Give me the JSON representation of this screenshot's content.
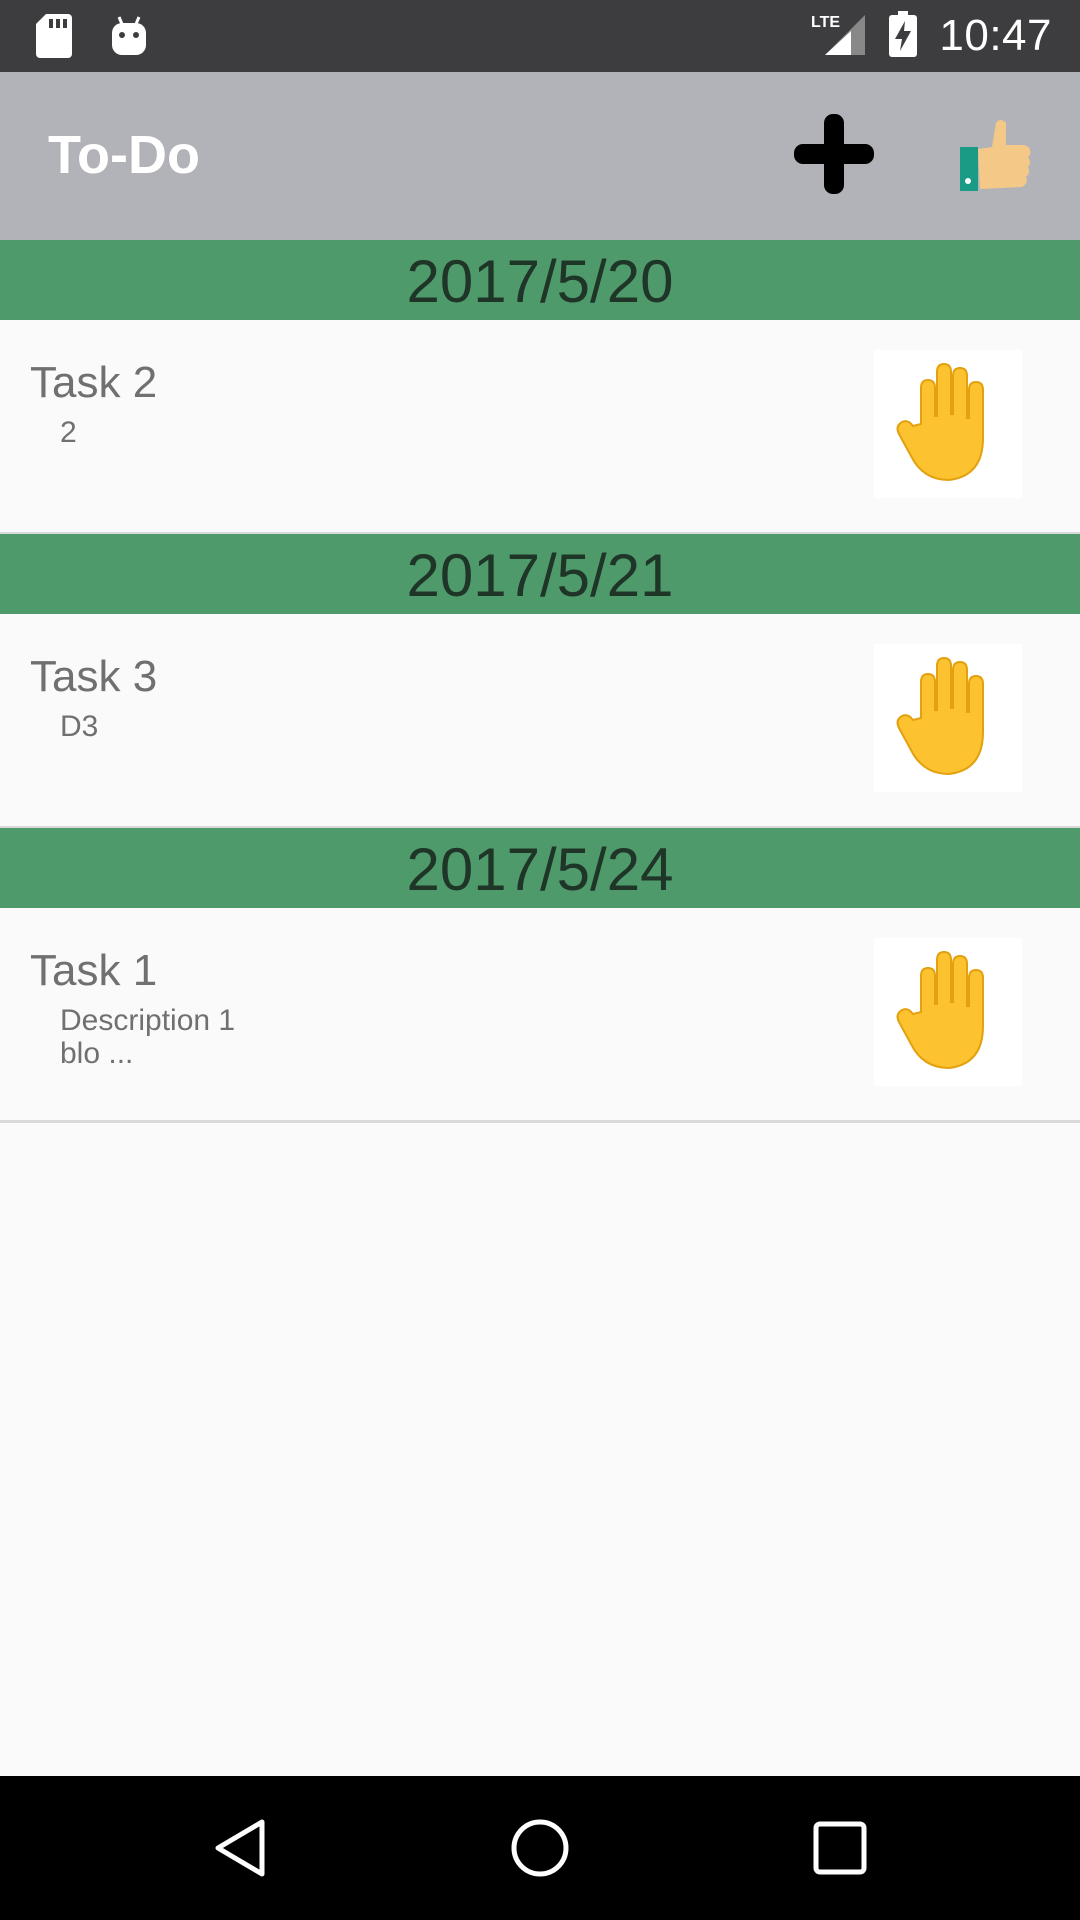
{
  "status_bar": {
    "time": "10:47",
    "network": "LTE",
    "icons": [
      "sd-card-icon",
      "android-icon",
      "lte-signal-icon",
      "battery-charging-icon"
    ]
  },
  "app_bar": {
    "title": "To-Do",
    "actions": [
      "add-icon",
      "thumbs-up-icon"
    ]
  },
  "sections": [
    {
      "date": "2017/5/20",
      "task": {
        "title": "Task 2",
        "description": "2"
      }
    },
    {
      "date": "2017/5/21",
      "task": {
        "title": "Task 3",
        "description": "D3"
      }
    },
    {
      "date": "2017/5/24",
      "task": {
        "title": "Task 1",
        "description": "Description 1\nblo ..."
      }
    }
  ],
  "nav_bar": {
    "icons": [
      "back-icon",
      "home-icon",
      "recents-icon"
    ]
  },
  "colors": {
    "status_bar": "#3d3d3f",
    "app_bar": "#b2b3b8",
    "date_header": "#4f9a6b",
    "background": "#fafafa"
  }
}
